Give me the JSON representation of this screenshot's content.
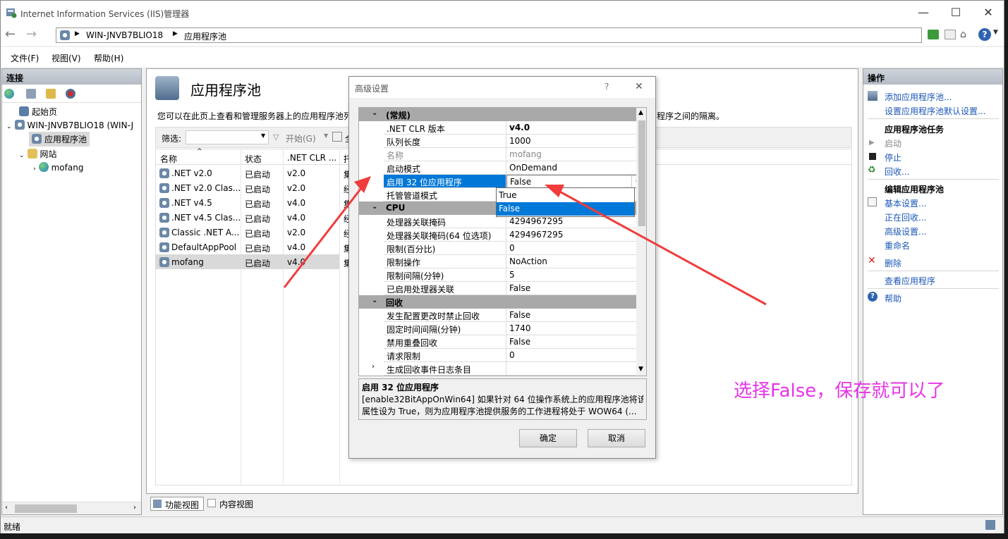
{
  "window": {
    "title": "Internet Information Services (IIS)管理器",
    "minimize": "—",
    "maximize": "☐",
    "close": "✕"
  },
  "nav": {
    "back": "←",
    "forward": "→",
    "breadcrumb": [
      "WIN-JNVB7BLIO18",
      "应用程序池"
    ],
    "help": "?"
  },
  "menu": [
    "文件(F)",
    "视图(V)",
    "帮助(H)"
  ],
  "left": {
    "header": "连接",
    "tree": [
      "起始页",
      "WIN-JNVB7BLIO18 (WIN-J",
      "应用程序池",
      "网站",
      "mofang"
    ]
  },
  "main": {
    "title": "应用程序池",
    "desc": "您可以在此页上查看和管理服务器上的应用程序池列",
    "desc_tail": "程序之间的隔离。",
    "filter_label": "筛选:",
    "start_label": "开始(G)",
    "show_all": "全",
    "columns": [
      "名称",
      "状态",
      ".NET CLR ...",
      "托"
    ],
    "rows": [
      {
        "name": ".NET v2.0",
        "status": "已启动",
        "clr": "v2.0",
        "mode": "集"
      },
      {
        "name": ".NET v2.0 Clas...",
        "status": "已启动",
        "clr": "v2.0",
        "mode": "经"
      },
      {
        "name": ".NET v4.5",
        "status": "已启动",
        "clr": "v4.0",
        "mode": "集"
      },
      {
        "name": ".NET v4.5 Clas...",
        "status": "已启动",
        "clr": "v4.0",
        "mode": "经"
      },
      {
        "name": "Classic .NET A...",
        "status": "已启动",
        "clr": "v2.0",
        "mode": "经"
      },
      {
        "name": "DefaultAppPool",
        "status": "已启动",
        "clr": "v4.0",
        "mode": "集"
      },
      {
        "name": "mofang",
        "status": "已启动",
        "clr": "v4.0",
        "mode": "集"
      }
    ],
    "tabs": [
      "功能视图",
      "内容视图"
    ]
  },
  "dialog": {
    "title": "高级设置",
    "help": "?",
    "close": "✕",
    "cat_general": "(常规)",
    "general": [
      {
        "name": ".NET CLR 版本",
        "value": "v4.0"
      },
      {
        "name": "队列长度",
        "value": "1000"
      },
      {
        "name": "名称",
        "value": "mofang"
      },
      {
        "name": "启动模式",
        "value": "OnDemand"
      },
      {
        "name": "启用 32 位应用程序",
        "value": "False"
      },
      {
        "name": "托管管道模式",
        "value": ""
      }
    ],
    "cat_cpu": "CPU",
    "cpu": [
      {
        "name": "处理器关联掩码",
        "value": "4294967295"
      },
      {
        "name": "处理器关联掩码(64 位选项)",
        "value": "4294967295"
      },
      {
        "name": "限制(百分比)",
        "value": "0"
      },
      {
        "name": "限制操作",
        "value": "NoAction"
      },
      {
        "name": "限制间隔(分钟)",
        "value": "5"
      },
      {
        "name": "已启用处理器关联",
        "value": "False"
      }
    ],
    "cat_recycle": "回收",
    "recycle": [
      {
        "name": "发生配置更改时禁止回收",
        "value": "False"
      },
      {
        "name": "固定时间间隔(分钟)",
        "value": "1740"
      },
      {
        "name": "禁用重叠回收",
        "value": "False"
      },
      {
        "name": "请求限制",
        "value": "0"
      },
      {
        "name": "生成回收事件日志条目",
        "value": ""
      }
    ],
    "dropdown_options": [
      "True",
      "False"
    ],
    "desc_title": "启用 32 位应用程序",
    "desc_line1": "[enable32BitAppOnWin64] 如果针对 64 位操作系统上的应用程序池将该",
    "desc_line2": "属性设为 True，则为应用程序池提供服务的工作进程将处于 WOW64 (...",
    "ok": "确定",
    "cancel": "取消"
  },
  "right": {
    "header": "操作",
    "add_pool": "添加应用程序池...",
    "set_defaults": "设置应用程序池默认设置...",
    "tasks_header": "应用程序池任务",
    "start": "启动",
    "stop": "停止",
    "recycle": "回收...",
    "edit_header": "编辑应用程序池",
    "basic": "基本设置...",
    "recycling": "正在回收...",
    "advanced": "高级设置...",
    "rename": "重命名",
    "delete": "删除",
    "view_apps": "查看应用程序",
    "help": "帮助"
  },
  "status": {
    "text": "就绪"
  },
  "annotation": {
    "text": "选择False，保存就可以了",
    "color": "#e834e8"
  }
}
